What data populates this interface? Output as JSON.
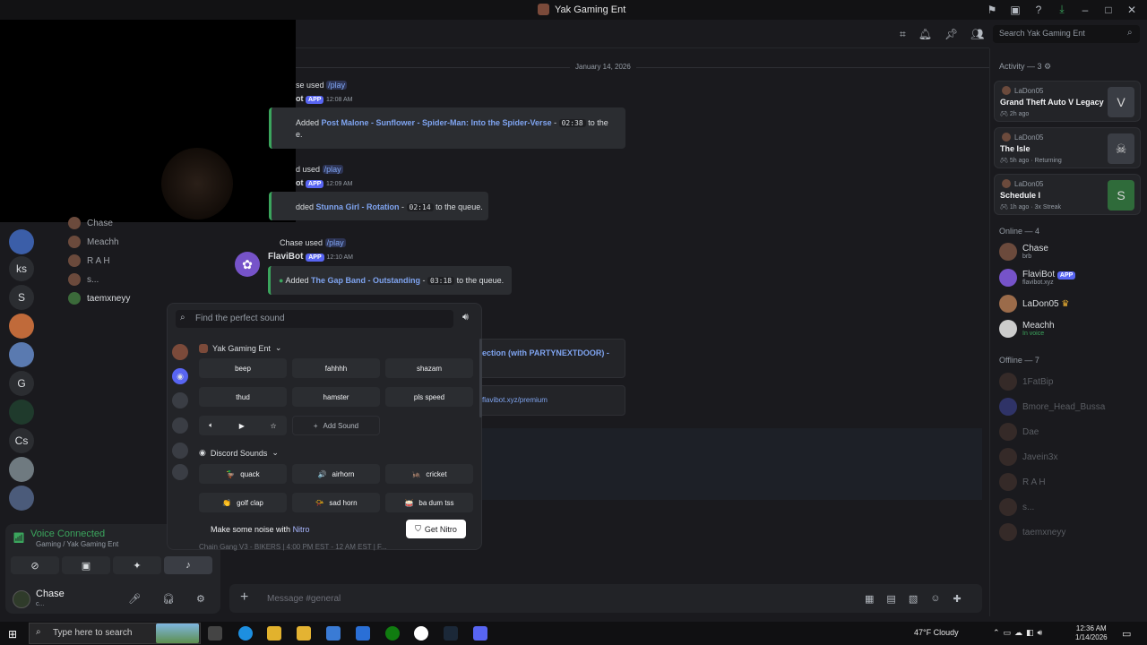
{
  "window": {
    "title": "Yak Gaming Ent"
  },
  "search": {
    "placeholder": "Search Yak Gaming Ent"
  },
  "chat": {
    "date_divider": "January 14, 2026",
    "messages": [
      {
        "reply_used": "used",
        "reply_cmd": "/play",
        "author_tail": "ot",
        "badge": "APP",
        "time": "12:08 AM",
        "embed_prefix": "Added",
        "track": "Post Malone - Sunflower - Spider-Man: Into the Spider-Verse",
        "duration": "02:38",
        "suffix": "to the",
        "suffix2": "e."
      },
      {
        "reply_used": "used",
        "reply_cmd": "/play",
        "author_tail": "ot",
        "badge": "APP",
        "time": "12:09 AM",
        "embed_prefix": "dded",
        "track": "Stunna Girl - Rotation",
        "duration": "02:14",
        "suffix": "to the queue."
      },
      {
        "reply_user": "Chase",
        "reply_used": "used",
        "reply_cmd": "/play",
        "author": "FlaviBot",
        "badge": "APP",
        "time": "12:10 AM",
        "embed_prefix": "Added",
        "track": "The Gap Band - Outstanding",
        "duration": "03:18",
        "suffix": "to the queue."
      }
    ],
    "partial_track": "ection (with PARTYNEXTDOOR) -",
    "partial_link": "flavibot.xyz/premium",
    "input_placeholder": "Message #general"
  },
  "rail": [
    "ks",
    "S",
    "G",
    "Cs"
  ],
  "channel_members": [
    "Chase",
    "Meachh",
    "R A H",
    "s...",
    "taemxneyy"
  ],
  "voice": {
    "status": "Voice Connected",
    "channel": "Gaming / Yak Gaming Ent"
  },
  "user": {
    "name": "Chase",
    "status": "c..."
  },
  "soundboard": {
    "search_placeholder": "Find the perfect sound",
    "server_cat": "Yak Gaming Ent",
    "server_sounds": [
      "beep",
      "fahhhh",
      "shazam",
      "thud",
      "hamster",
      "pls speed"
    ],
    "add_sound": "Add Sound",
    "discord_cat": "Discord Sounds",
    "discord_sounds": [
      {
        "emoji": "🦆",
        "label": "quack"
      },
      {
        "emoji": "🔊",
        "label": "airhorn"
      },
      {
        "emoji": "🦗",
        "label": "cricket"
      },
      {
        "emoji": "👏",
        "label": "golf clap"
      },
      {
        "emoji": "📯",
        "label": "sad horn"
      },
      {
        "emoji": "🥁",
        "label": "ba dum tss"
      }
    ],
    "nitro_text": "Make some noise with",
    "nitro_word": "Nitro",
    "nitro_btn": "Get Nitro",
    "behind_text": "Chain Gang V3 - BIKERS | 4:00 PM EST - 12 AM EST | F..."
  },
  "sidebar": {
    "activity_header": "Activity — 3",
    "activities": [
      {
        "user": "LaDon05",
        "game": "Grand Theft Auto V Legacy",
        "meta": "2h ago"
      },
      {
        "user": "LaDon05",
        "game": "The Isle",
        "meta": "5h ago · Returning"
      },
      {
        "user": "LaDon05",
        "game": "Schedule I",
        "meta": "1h ago · 3x Streak"
      }
    ],
    "online_header": "Online — 4",
    "online": [
      {
        "name": "Chase",
        "sub": "brb"
      },
      {
        "name": "FlaviBot",
        "sub": "flavibot.xyz",
        "badge": "APP"
      },
      {
        "name": "LaDon05",
        "sub": ""
      },
      {
        "name": "Meachh",
        "sub": "In voice"
      }
    ],
    "offline_header": "Offline — 7",
    "offline": [
      "1FatBip",
      "Bmore_Head_Bussa",
      "Dae",
      "Javein3x",
      "R A H",
      "s...",
      "taemxneyy"
    ]
  },
  "taskbar": {
    "search": "Type here to search",
    "weather": "47°F  Cloudy",
    "time": "12:36 AM",
    "date": "1/14/2026"
  }
}
